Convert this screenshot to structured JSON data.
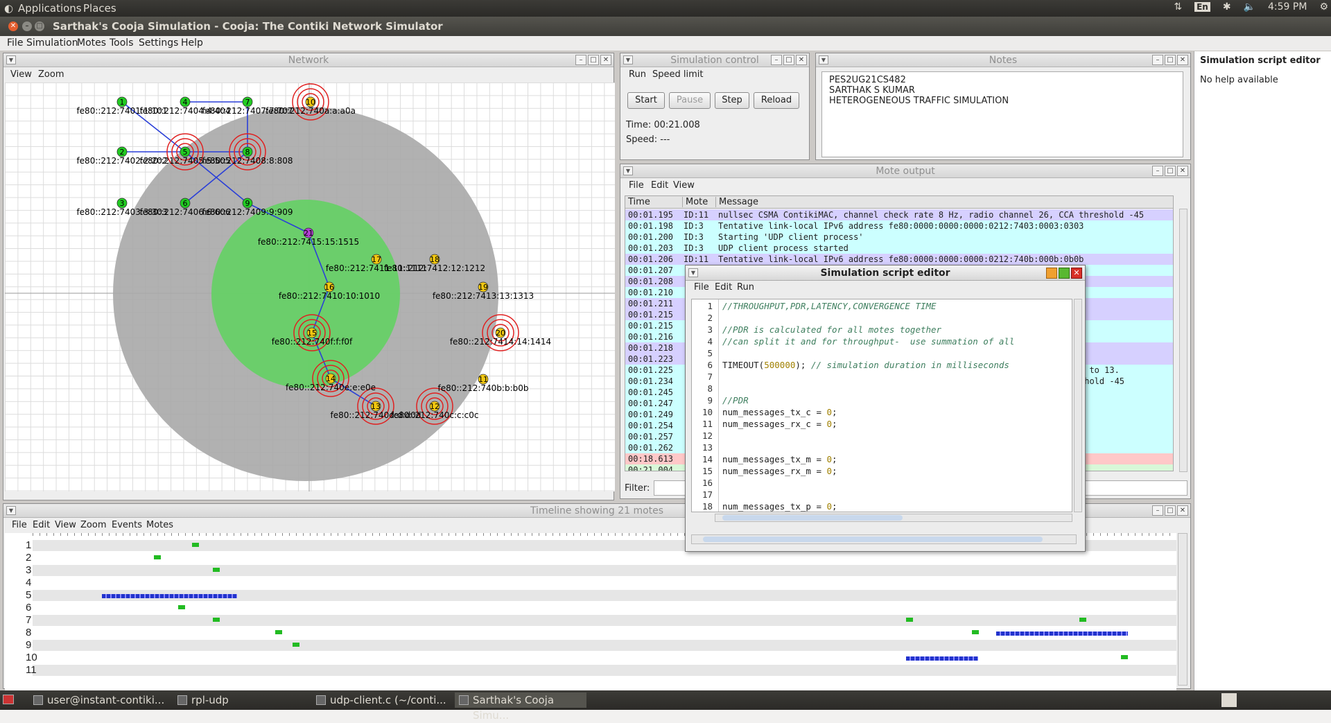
{
  "top_panel": {
    "applications": "Applications",
    "places": "Places",
    "lang": "En",
    "time": "4:59 PM"
  },
  "window": {
    "title": "Sarthak's Cooja Simulation - Cooja: The Contiki Network Simulator"
  },
  "menubar": [
    "File",
    "Simulation",
    "Motes",
    "Tools",
    "Settings",
    "Help"
  ],
  "network": {
    "title": "Network",
    "menu": [
      "View",
      "Zoom"
    ],
    "motes": [
      {
        "id": "1",
        "label": "fe80::212:7401:1:101",
        "color": "green"
      },
      {
        "id": "2",
        "label": "fe80::212:7402:2:202",
        "color": "green"
      },
      {
        "id": "3",
        "label": "fe80::212:7403:3:303",
        "color": "green"
      },
      {
        "id": "4",
        "label": "fe80::212:7404:4:404",
        "color": "green"
      },
      {
        "id": "5",
        "label": "fe80::212:7405:5:505",
        "color": "green"
      },
      {
        "id": "6",
        "label": "fe80::212:7406:6:606",
        "color": "green"
      },
      {
        "id": "7",
        "label": "fe80::212:7407:7:707",
        "color": "green"
      },
      {
        "id": "8",
        "label": "fe80::212:7408:8:808",
        "color": "green"
      },
      {
        "id": "9",
        "label": "fe80::212:7409:9:909",
        "color": "green"
      },
      {
        "id": "10",
        "label": "fe80::212:740a:a:a0a",
        "color": "yellow"
      },
      {
        "id": "11",
        "label": "fe80::212:740b:b:b0b",
        "color": "yellow"
      },
      {
        "id": "12",
        "label": "fe80::212:740c:c:c0c",
        "color": "yellow"
      },
      {
        "id": "13",
        "label": "fe80::212:740d:d:d0d",
        "color": "yellow"
      },
      {
        "id": "14",
        "label": "fe80::212:740e:e:e0e",
        "color": "yellow"
      },
      {
        "id": "15",
        "label": "fe80::212:740f:f:f0f",
        "color": "yellow"
      },
      {
        "id": "16",
        "label": "fe80::212:7410:10:1010",
        "color": "yellow"
      },
      {
        "id": "17",
        "label": "fe80::212:7411:11:1111",
        "color": "yellow"
      },
      {
        "id": "18",
        "label": "fe80::212:7412:12:1212",
        "color": "yellow"
      },
      {
        "id": "19",
        "label": "fe80::212:7413:13:1313",
        "color": "yellow"
      },
      {
        "id": "20",
        "label": "fe80::212:7414:14:1414",
        "color": "yellow"
      },
      {
        "id": "21",
        "label": "fe80::212:7415:15:1515",
        "color": "purple"
      }
    ]
  },
  "sim_control": {
    "title": "Simulation control",
    "menu": [
      "Run",
      "Speed limit"
    ],
    "buttons": {
      "start": "Start",
      "pause": "Pause",
      "step": "Step",
      "reload": "Reload"
    },
    "time": "Time: 00:21.008",
    "speed": "Speed: ---"
  },
  "notes": {
    "title": "Notes",
    "lines": [
      "PES2UG21CS482",
      "SARTHAK S KUMAR",
      "HETEROGENEOUS TRAFFIC SIMULATION"
    ]
  },
  "mote_output": {
    "title": "Mote output",
    "menu": [
      "File",
      "Edit",
      "View"
    ],
    "columns": [
      "Time",
      "Mote",
      "Message"
    ],
    "filter_label": "Filter:",
    "rows": [
      {
        "time": "00:01.195",
        "mote": "ID:11",
        "msg": "nullsec CSMA ContikiMAC, channel check rate 8 Hz, radio channel 26, CCA threshold -45",
        "bg": "#d6d0ff"
      },
      {
        "time": "00:01.198",
        "mote": "ID:3",
        "msg": "Tentative link-local IPv6 address fe80:0000:0000:0000:0212:7403:0003:0303",
        "bg": "#ccffff"
      },
      {
        "time": "00:01.200",
        "mote": "ID:3",
        "msg": "Starting 'UDP client process'",
        "bg": "#ccffff"
      },
      {
        "time": "00:01.203",
        "mote": "ID:3",
        "msg": "UDP client process started",
        "bg": "#ccffff"
      },
      {
        "time": "00:01.206",
        "mote": "ID:11",
        "msg": "Tentative link-local IPv6 address fe80:0000:0000:0000:0212:740b:000b:0b0b",
        "bg": "#d6d0ff"
      },
      {
        "time": "00:01.207",
        "mote": "",
        "msg": "",
        "bg": "#ccffff"
      },
      {
        "time": "00:01.208",
        "mote": "",
        "msg": "",
        "bg": "#d6d0ff"
      },
      {
        "time": "00:01.210",
        "mote": "",
        "msg": "",
        "bg": "#ccffff"
      },
      {
        "time": "00:01.211",
        "mote": "",
        "msg": "",
        "bg": "#d6d0ff"
      },
      {
        "time": "00:01.215",
        "mote": "",
        "msg": "",
        "bg": "#d6d0ff"
      },
      {
        "time": "00:01.215",
        "mote": "",
        "msg": "",
        "bg": "#ccffff"
      },
      {
        "time": "00:01.216",
        "mote": "",
        "msg": "",
        "bg": "#ccffff"
      },
      {
        "time": "00:01.218",
        "mote": "",
        "msg": "",
        "bg": "#d6d0ff"
      },
      {
        "time": "00:01.223",
        "mote": "",
        "msg": "",
        "bg": "#d6d0ff"
      },
      {
        "time": "00:01.225",
        "mote": "",
        "msg": "t to 13.",
        "bg": "#ccffff"
      },
      {
        "time": "00:01.234",
        "mote": "",
        "msg": "shold -45",
        "bg": "#ccffff"
      },
      {
        "time": "00:01.245",
        "mote": "",
        "msg": "",
        "bg": "#ccffff"
      },
      {
        "time": "00:01.247",
        "mote": "",
        "msg": "",
        "bg": "#ccffff"
      },
      {
        "time": "00:01.249",
        "mote": "",
        "msg": "",
        "bg": "#ccffff"
      },
      {
        "time": "00:01.254",
        "mote": "",
        "msg": "",
        "bg": "#ccffff"
      },
      {
        "time": "00:01.257",
        "mote": "",
        "msg": "",
        "bg": "#ccffff"
      },
      {
        "time": "00:01.262",
        "mote": "",
        "msg": "",
        "bg": "#ccffff"
      },
      {
        "time": "00:18.613",
        "mote": "",
        "msg": "",
        "bg": "#ffc8c8"
      },
      {
        "time": "00:21.004",
        "mote": "",
        "msg": "",
        "bg": "#d8f8d8"
      }
    ]
  },
  "timeline": {
    "title": "Timeline showing 21 motes",
    "menu": [
      "File",
      "Edit",
      "View",
      "Zoom",
      "Events",
      "Motes"
    ],
    "rows": [
      "1",
      "2",
      "3",
      "4",
      "5",
      "6",
      "7",
      "8",
      "9",
      "10",
      "11"
    ]
  },
  "script_editor": {
    "title": "Simulation script editor",
    "menu": [
      "File",
      "Edit",
      "Run"
    ],
    "lines": [
      {
        "n": "1",
        "code": "//THROUGHPUT,PDR,LATENCY,CONVERGENCE TIME"
      },
      {
        "n": "2",
        "code": ""
      },
      {
        "n": "3",
        "code": "//PDR is calculated for all motes together"
      },
      {
        "n": "4",
        "code": "//can split it and for throughput-  use summation of all"
      },
      {
        "n": "5",
        "code": ""
      },
      {
        "n": "6",
        "code": "TIMEOUT(500000); // simulation duration in milliseconds"
      },
      {
        "n": "7",
        "code": ""
      },
      {
        "n": "8",
        "code": ""
      },
      {
        "n": "9",
        "code": "//PDR"
      },
      {
        "n": "10",
        "code": "num_messages_tx_c = 0;"
      },
      {
        "n": "11",
        "code": "num_messages_rx_c = 0;"
      },
      {
        "n": "12",
        "code": ""
      },
      {
        "n": "13",
        "code": ""
      },
      {
        "n": "14",
        "code": "num_messages_tx_m = 0;"
      },
      {
        "n": "15",
        "code": "num_messages_rx_m = 0;"
      },
      {
        "n": "16",
        "code": ""
      },
      {
        "n": "17",
        "code": ""
      },
      {
        "n": "18",
        "code": "num_messages_tx_p = 0;"
      }
    ]
  },
  "help_panel": {
    "title": "Simulation script editor",
    "body": "No help available"
  },
  "taskbar": [
    {
      "label": "user@instant-contiki...",
      "active": false
    },
    {
      "label": "rpl-udp",
      "active": false
    },
    {
      "label": "udp-client.c (~/conti...",
      "active": false
    },
    {
      "label": "Sarthak's Cooja Simu...",
      "active": true
    }
  ]
}
